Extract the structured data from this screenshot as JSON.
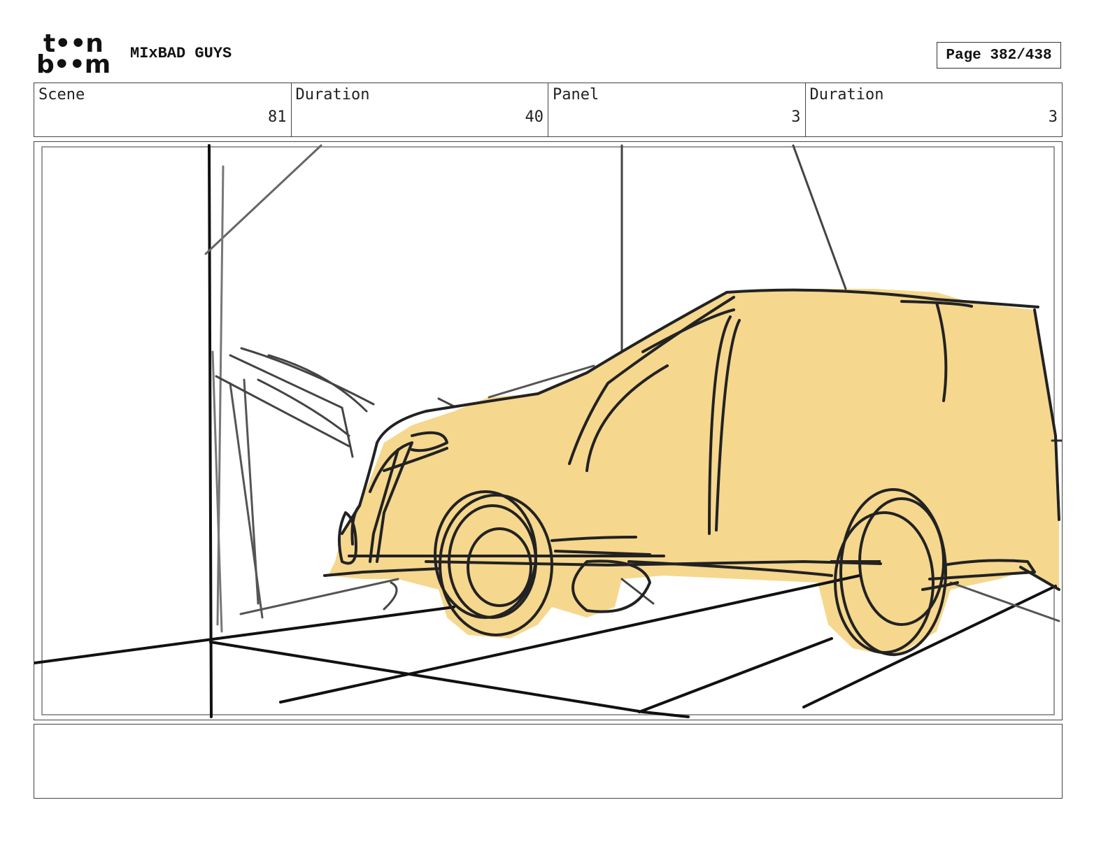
{
  "header": {
    "logo_line1": "t••n",
    "logo_line2": "b••m",
    "project_title": "MIxBAD GUYS",
    "page_indicator": "Page 382/438"
  },
  "info": [
    {
      "label": "Scene",
      "value": "81"
    },
    {
      "label": "Duration",
      "value": "40"
    },
    {
      "label": "Panel",
      "value": "3"
    },
    {
      "label": "Duration",
      "value": "3"
    }
  ],
  "panel": {
    "fill_color": "#f5d78e",
    "line_color": "#222222",
    "guide_color": "#555555"
  },
  "notes": {
    "text": ""
  }
}
